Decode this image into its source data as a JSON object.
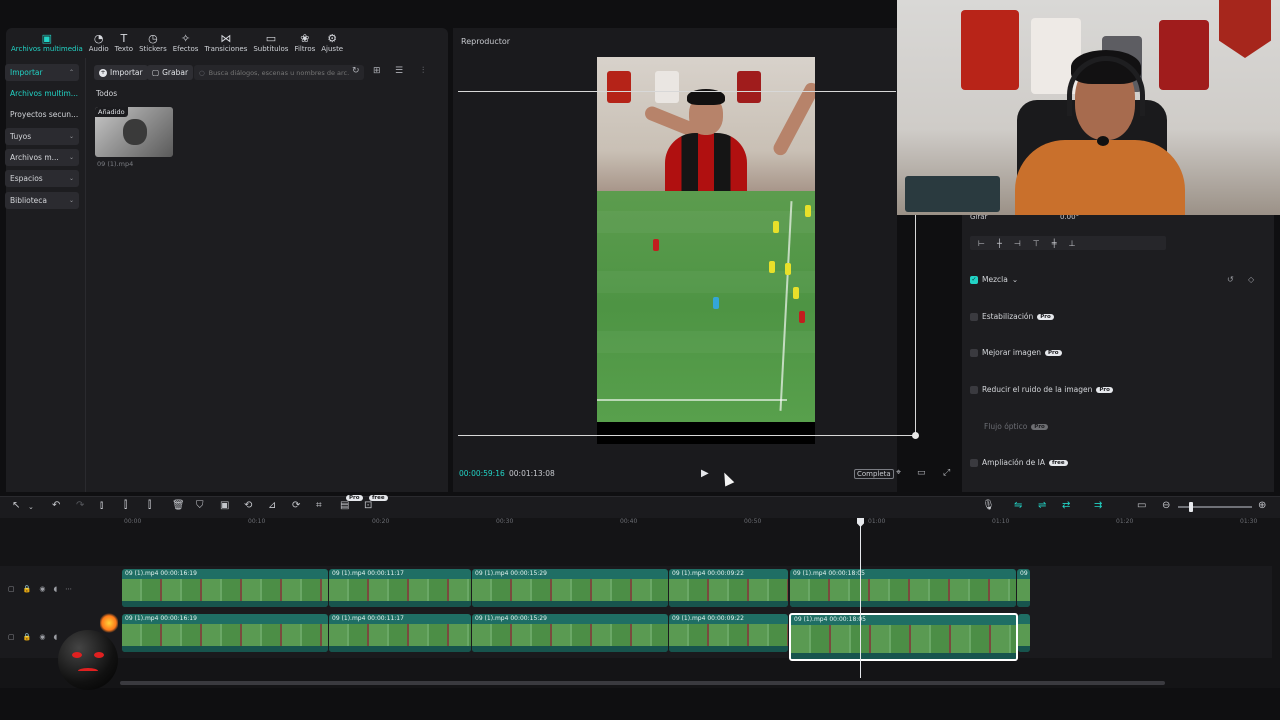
{
  "toolbar": {
    "items": [
      {
        "label": "Archivos multimedia",
        "icon": "media-icon"
      },
      {
        "label": "Audio",
        "icon": "audio-icon"
      },
      {
        "label": "Texto",
        "icon": "text-icon"
      },
      {
        "label": "Stickers",
        "icon": "sticker-icon"
      },
      {
        "label": "Efectos",
        "icon": "effects-icon"
      },
      {
        "label": "Transiciones",
        "icon": "transition-icon"
      },
      {
        "label": "Subtítulos",
        "icon": "subtitle-icon"
      },
      {
        "label": "Filtros",
        "icon": "filter-icon"
      },
      {
        "label": "Ajuste",
        "icon": "adjust-icon"
      }
    ]
  },
  "sidebar": {
    "items": [
      {
        "label": "Importar"
      },
      {
        "label": "Archivos multim..."
      },
      {
        "label": "Proyectos secun..."
      },
      {
        "label": "Tuyos"
      },
      {
        "label": "Archivos m..."
      },
      {
        "label": "Espacios"
      },
      {
        "label": "Biblioteca"
      }
    ]
  },
  "content": {
    "import_label": "Importar",
    "record_label": "Grabar",
    "search_placeholder": "Busca diálogos, escenas u nombres de arc...",
    "tab_all": "Todos",
    "thumb_badge": "Añadido",
    "thumb_name": "09 (1).mp4"
  },
  "player": {
    "title": "Reproductor",
    "time_current": "00:00:59:16",
    "time_total": "00:01:13:08",
    "full_label": "Completa"
  },
  "props": {
    "rotate_label": "Girar",
    "rotate_value": "0.00°",
    "blend_label": "Mezcla",
    "stabilize_label": "Estabilización",
    "enhance_label": "Mejorar imagen",
    "denoise_label": "Reducir el ruido de la imagen",
    "optical_label": "Flujo óptico",
    "ai_expand_label": "Ampliación de IA",
    "pro": "Pro",
    "free": "free"
  },
  "timeline": {
    "ruler": [
      "00:00",
      "00:10",
      "00:20",
      "00:30",
      "00:40",
      "00:50",
      "01:00",
      "01:10",
      "01:20",
      "01:30"
    ],
    "track1_clips": [
      {
        "label": "09 (1).mp4   00:00:16:19"
      },
      {
        "label": "09 (1).mp4   00:00:11:17"
      },
      {
        "label": "09 (1).mp4   00:00:15:29"
      },
      {
        "label": "09 (1).mp4   00:00:09:22"
      },
      {
        "label": "09 (1).mp4   00:00:18:05"
      },
      {
        "label": "09"
      }
    ],
    "track2_clips": [
      {
        "label": "09 (1).mp4   00:00:16:19"
      },
      {
        "label": "09 (1).mp4   00:00:11:17"
      },
      {
        "label": "09 (1).mp4   00:00:15:29"
      },
      {
        "label": "09 (1).mp4   00:00:09:22"
      },
      {
        "label": "09 (1).mp4   00:00:18:05"
      }
    ],
    "pro": "Pro",
    "free": "free"
  },
  "colors": {
    "accent": "#22d3c5",
    "clip": "#1f6e64",
    "panel": "#1d1d20"
  }
}
